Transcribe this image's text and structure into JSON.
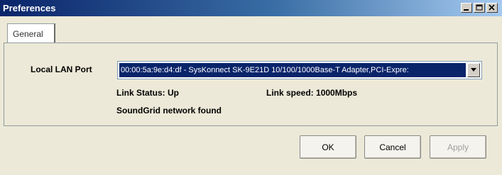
{
  "window": {
    "title": "Preferences",
    "controls": [
      {
        "name": "minimize-button",
        "icon": "minimize-icon"
      },
      {
        "name": "maximize-button",
        "icon": "maximize-icon"
      },
      {
        "name": "close-button",
        "icon": "close-icon"
      }
    ]
  },
  "tabs": [
    {
      "label": "General",
      "selected": true
    }
  ],
  "general": {
    "local_lan_port_label": "Local LAN Port",
    "local_lan_port_value": "00:00:5a:9e:d4:df - SysKonnect SK-9E21D 10/100/1000Base-T Adapter,PCI-Expre:",
    "link_status": "Link Status: Up",
    "link_speed": "Link speed: 1000Mbps",
    "network_status": "SoundGrid network found"
  },
  "buttons": {
    "ok": "OK",
    "cancel": "Cancel",
    "apply": "Apply",
    "apply_enabled": false
  },
  "colors": {
    "titlebar_start": "#0a246a",
    "titlebar_end": "#a6caf0",
    "selection": "#0a246a",
    "window_bg": "#ece9d8"
  }
}
